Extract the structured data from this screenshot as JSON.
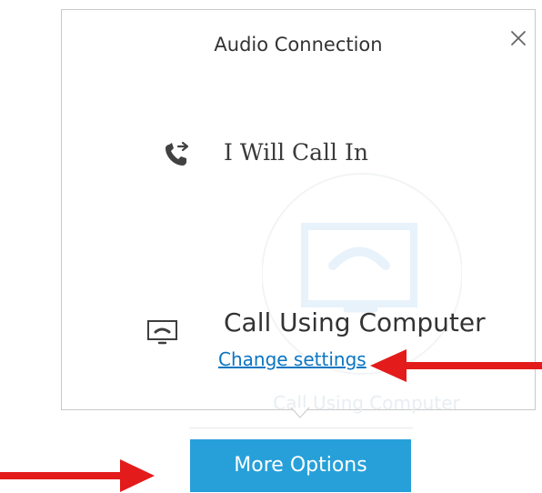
{
  "dialog": {
    "title": "Audio Connection",
    "close_icon": "close-icon",
    "options": {
      "call_in": {
        "label": "I Will Call In",
        "icon": "phone-forward-icon"
      },
      "call_computer": {
        "label": "Call Using Computer",
        "icon": "computer-phone-icon",
        "settings_link": "Change settings"
      }
    },
    "watermark": {
      "label": "Call Using Computer"
    }
  },
  "footer": {
    "more_options": "More Options"
  },
  "annotations": [
    {
      "name": "red-arrow-right",
      "color": "#e31b1b"
    },
    {
      "name": "red-arrow-left",
      "color": "#e31b1b"
    }
  ],
  "colors": {
    "dialog_border": "#c9c9c9",
    "text": "#333333",
    "link": "#0a75c2",
    "button": "#27a0d9",
    "button_text": "#ffffff",
    "watermark": "#e8eef2",
    "annotation": "#e31b1b"
  }
}
